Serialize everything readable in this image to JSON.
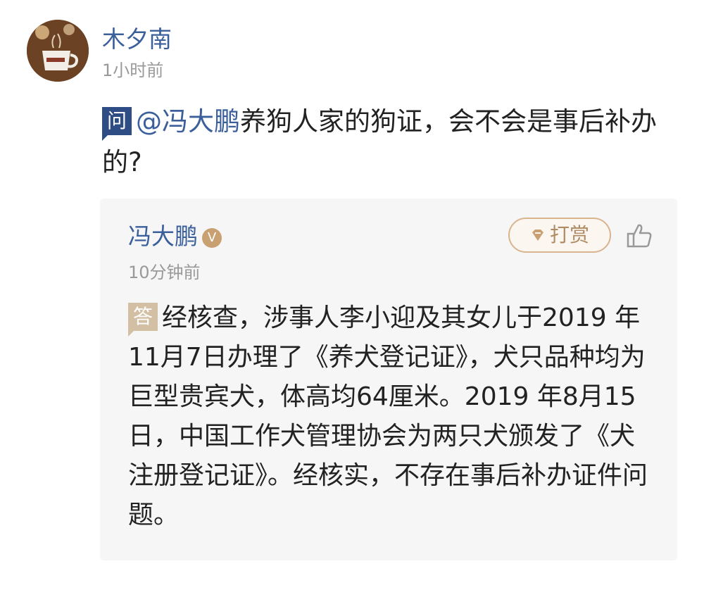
{
  "post": {
    "username": "木夕南",
    "time": "1小时前",
    "question_badge": "问",
    "mention": "@冯大鹏",
    "question_text": "养狗人家的狗证，会不会是事后补办的?"
  },
  "reply": {
    "name": "冯大鹏",
    "verified_badge": "V",
    "reward_label": "打赏",
    "time": "10分钟前",
    "answer_badge": "答",
    "answer_text": "经核查，涉事人李小迎及其女儿于2019 年11月7日办理了《养犬登记证》，犬只品种均为巨型贵宾犬，体高均64厘米。2019 年8月15日，中国工作犬管理协会为两只犬颁发了《犬注册登记证》。经核实，不存在事后补办证件问题。"
  },
  "icons": {
    "avatar": "coffee-cup-avatar",
    "reward": "gem-icon",
    "like": "thumbs-up-icon"
  },
  "colors": {
    "link_blue": "#3a5f9a",
    "question_badge": "#2e4d85",
    "answer_badge": "#d3bfa4",
    "reward_gold": "#b08a63",
    "muted_text": "#999999",
    "card_background": "#f6f6f6"
  }
}
